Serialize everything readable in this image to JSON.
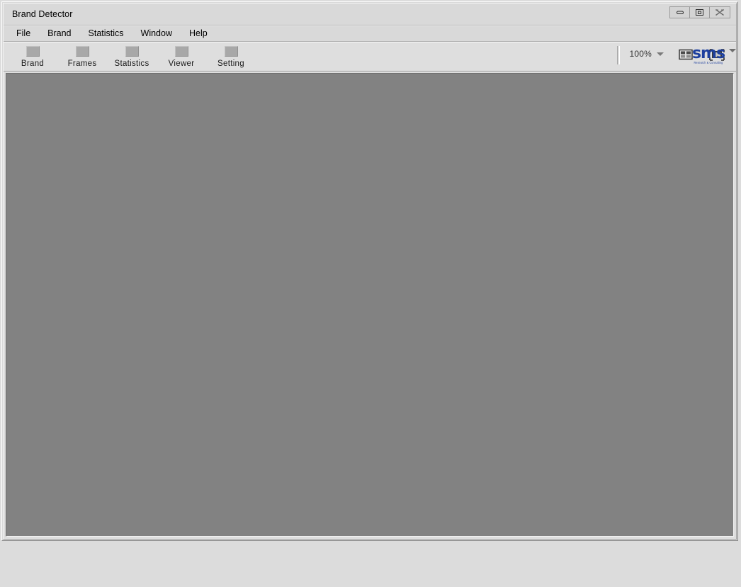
{
  "window": {
    "title": "Brand Detector",
    "controls": [
      {
        "name": "minimize-button",
        "icon": "minimize-icon",
        "label": "Minimize"
      },
      {
        "name": "restore-button",
        "icon": "restore-icon",
        "label": "Restore"
      },
      {
        "name": "close-button",
        "icon": "close-icon",
        "label": "Close"
      }
    ]
  },
  "menubar": {
    "items": [
      {
        "label": "File"
      },
      {
        "label": "Brand"
      },
      {
        "label": "Statistics"
      },
      {
        "label": "Window"
      },
      {
        "label": "Help"
      }
    ]
  },
  "toolbar": {
    "buttons": [
      {
        "label": "Brand",
        "icon": "brand-icon"
      },
      {
        "label": "Frames",
        "icon": "frames-icon"
      },
      {
        "label": "Statistics",
        "icon": "statistics-icon"
      },
      {
        "label": "Viewer",
        "icon": "viewer-icon"
      },
      {
        "label": "Setting",
        "icon": "setting-icon"
      }
    ],
    "zoom": {
      "value": "100%",
      "dropdown_icon": "chevron-down-icon"
    },
    "grid_view_button": {
      "icon": "grid-layout-icon",
      "label": "Grid layout"
    },
    "display_button": {
      "icon": "fit-to-screen-icon",
      "label": "Fit to screen",
      "dropdown_icon": "chevron-down-icon"
    }
  },
  "logo": {
    "mark": "sms",
    "tagline": "Research & Consulting"
  },
  "colors": {
    "content_background": "#828282",
    "chrome_background": "#dcdcdc",
    "toolbar_background": "#dedede",
    "logo_blue": "#1d3f9e"
  },
  "content": {
    "empty": true
  },
  "statusbar": {
    "text": ""
  }
}
